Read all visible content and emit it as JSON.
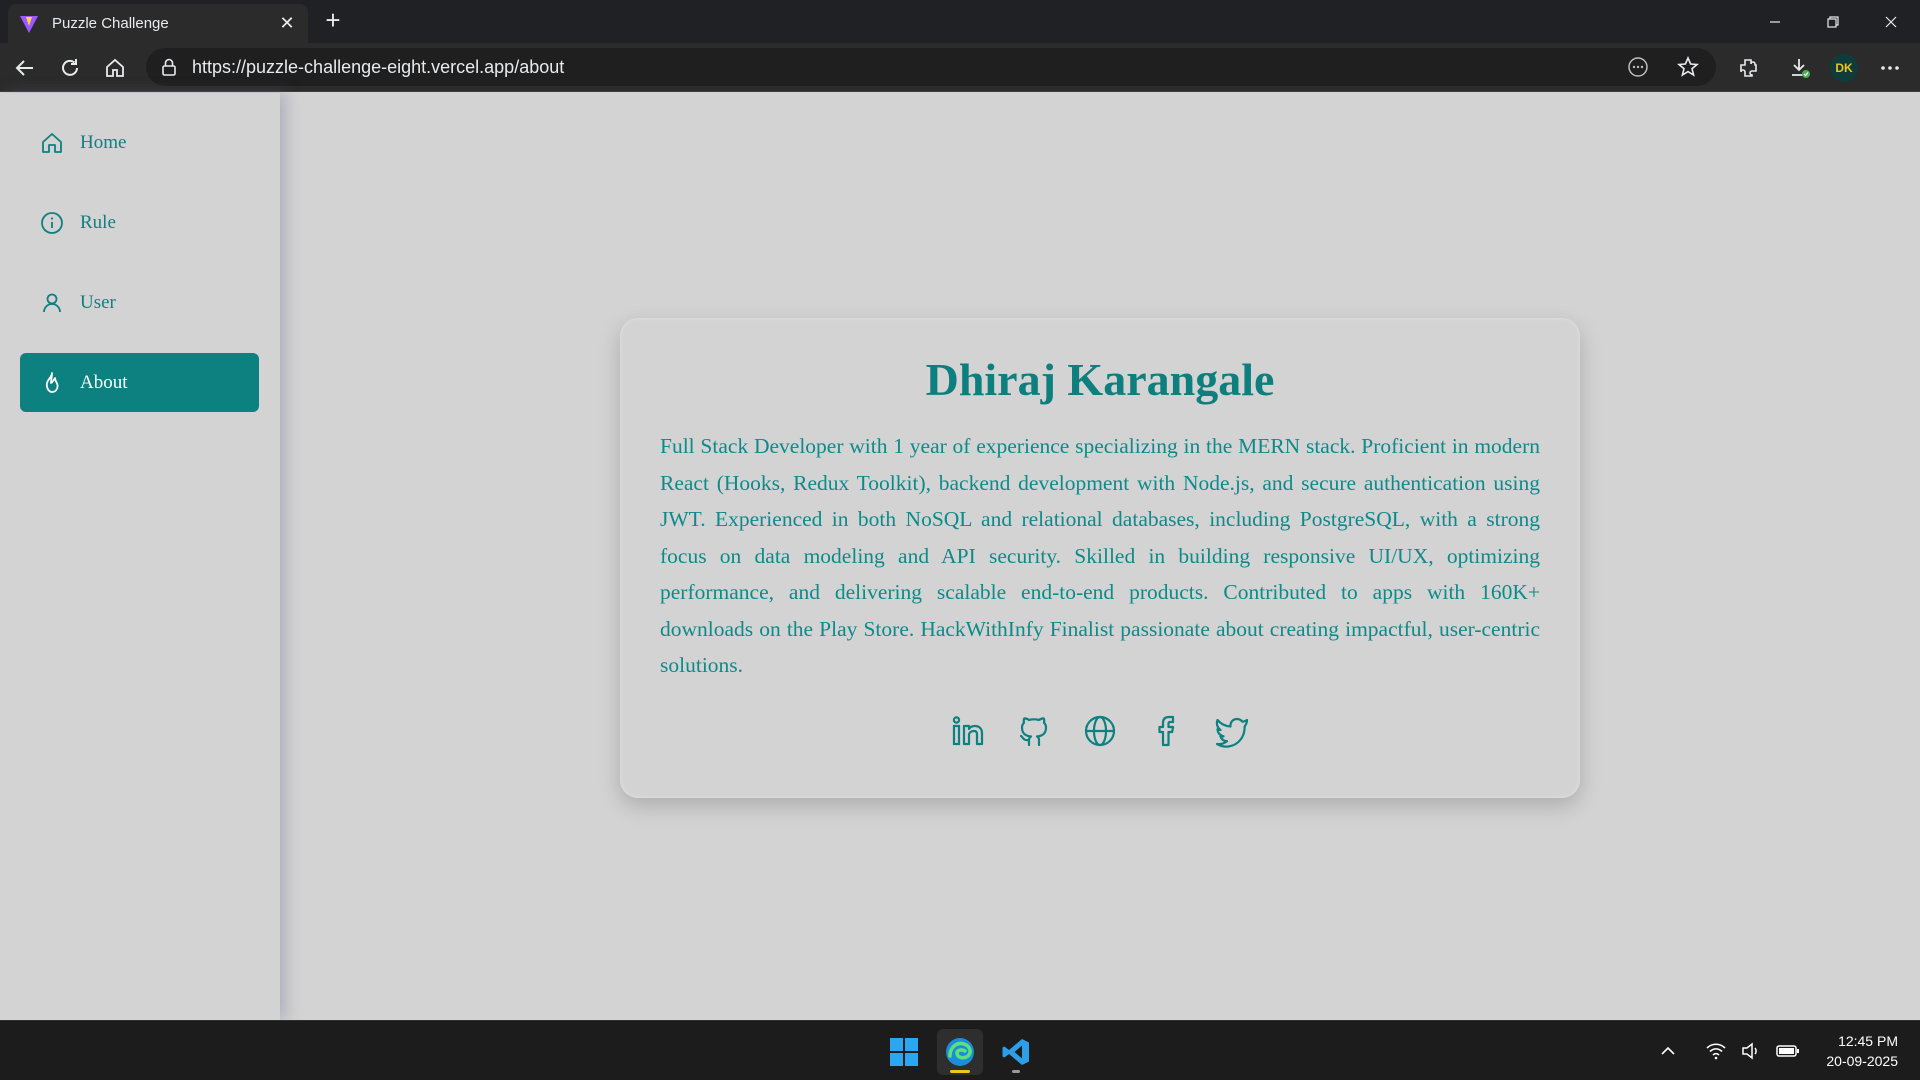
{
  "browser": {
    "tab_title": "Puzzle Challenge",
    "url": "https://puzzle-challenge-eight.vercel.app/about",
    "avatar_initials": "DK"
  },
  "sidebar": {
    "items": [
      {
        "label": "Home",
        "icon": "home-icon"
      },
      {
        "label": "Rule",
        "icon": "info-icon"
      },
      {
        "label": "User",
        "icon": "user-icon"
      },
      {
        "label": "About",
        "icon": "flame-icon",
        "active": true
      }
    ]
  },
  "profile": {
    "name": "Dhiraj Karangale",
    "bio": "Full Stack Developer with 1 year of experience specializing in the MERN stack. Proficient in modern React (Hooks, Redux Toolkit), backend development with Node.js, and secure authentication using JWT. Experienced in both NoSQL and relational databases, including PostgreSQL, with a strong focus on data modeling and API security. Skilled in building responsive UI/UX, optimizing performance, and delivering scalable end-to-end products. Contributed to apps with 160K+ downloads on the Play Store. HackWithInfy Finalist passionate about creating impactful, user-centric solutions.",
    "social": [
      "linkedin-icon",
      "github-icon",
      "globe-icon",
      "facebook-icon",
      "twitter-icon"
    ]
  },
  "taskbar": {
    "time": "12:45 PM",
    "date": "20-09-2025"
  },
  "colors": {
    "accent": "#0d8080",
    "page_bg": "#d3d3d3"
  }
}
